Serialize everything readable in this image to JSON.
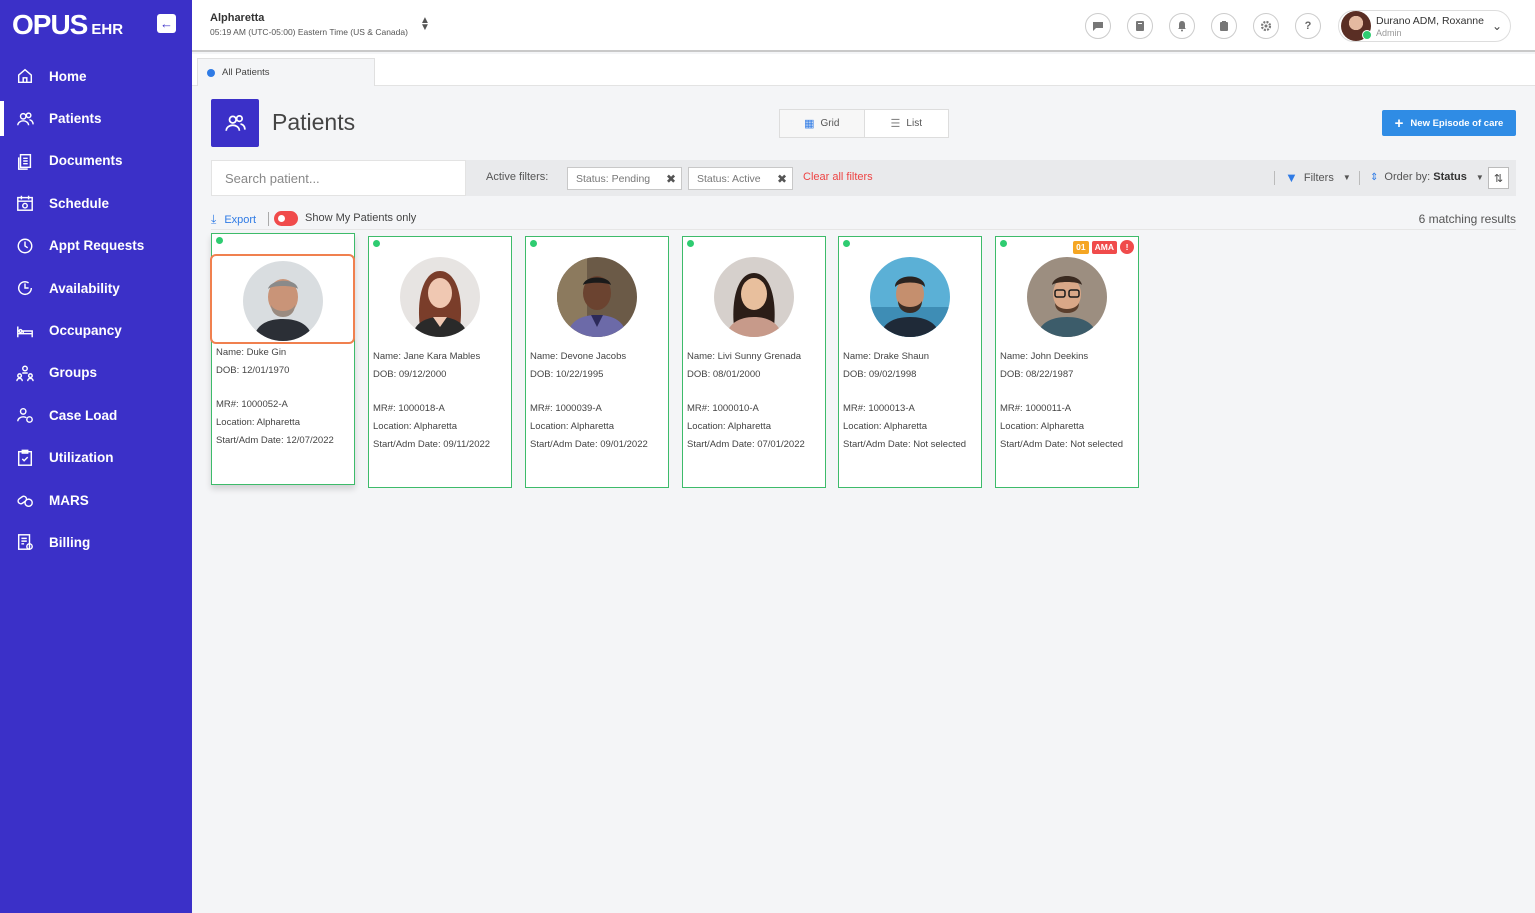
{
  "app": {
    "logo": "OPUS",
    "logo_sub": "EHR"
  },
  "sidebar": {
    "items": [
      {
        "label": "Home",
        "icon": "home-icon"
      },
      {
        "label": "Patients",
        "icon": "patients-icon",
        "active": true
      },
      {
        "label": "Documents",
        "icon": "documents-icon"
      },
      {
        "label": "Schedule",
        "icon": "schedule-icon"
      },
      {
        "label": "Appt Requests",
        "icon": "clock-icon"
      },
      {
        "label": "Availability",
        "icon": "availability-icon"
      },
      {
        "label": "Occupancy",
        "icon": "bed-icon"
      },
      {
        "label": "Groups",
        "icon": "groups-icon"
      },
      {
        "label": "Case Load",
        "icon": "case-load-icon"
      },
      {
        "label": "Utilization",
        "icon": "clipboard-icon"
      },
      {
        "label": "MARS",
        "icon": "pills-icon"
      },
      {
        "label": "Billing",
        "icon": "billing-icon"
      }
    ]
  },
  "topbar": {
    "location": "Alpharetta",
    "time": "05:19 AM (UTC-05:00) Eastern Time (US & Canada)",
    "user_name": "Durano ADM, Roxanne",
    "user_role": "Admin"
  },
  "tabs": [
    {
      "label": "All Patients"
    }
  ],
  "header": {
    "title": "Patients",
    "view_grid": "Grid",
    "view_list": "List",
    "new_button": "New Episode of care"
  },
  "filters": {
    "search_placeholder": "Search patient...",
    "active_label": "Active filters:",
    "chips": [
      "Status: Pending",
      "Status: Active"
    ],
    "clear_all": "Clear all filters",
    "filters_label": "Filters",
    "order_label": "Order by:",
    "order_value": "Status"
  },
  "toolbar": {
    "export": "Export",
    "show_mine": "Show My Patients only",
    "results": "6 matching results"
  },
  "patients": [
    {
      "name": "Name: Duke Gin",
      "dob": "DOB: 12/01/1970",
      "mr": "MR#: 1000052-A",
      "location": "Location: Alpharetta",
      "start": "Start/Adm Date: 12/07/2022"
    },
    {
      "name": "Name: Jane Kara Mables",
      "dob": "DOB: 09/12/2000",
      "mr": "MR#: 1000018-A",
      "location": "Location: Alpharetta",
      "start": "Start/Adm Date: 09/11/2022"
    },
    {
      "name": "Name: Devone Jacobs",
      "dob": "DOB: 10/22/1995",
      "mr": "MR#: 1000039-A",
      "location": "Location: Alpharetta",
      "start": "Start/Adm Date: 09/01/2022"
    },
    {
      "name": "Name: Livi Sunny Grenada",
      "dob": "DOB: 08/01/2000",
      "mr": "MR#: 1000010-A",
      "location": "Location: Alpharetta",
      "start": "Start/Adm Date: 07/01/2022"
    },
    {
      "name": "Name: Drake Shaun",
      "dob": "DOB: 09/02/1998",
      "mr": "MR#: 1000013-A",
      "location": "Location: Alpharetta",
      "start": "Start/Adm Date: Not selected"
    },
    {
      "name": "Name: John Deekins",
      "dob": "DOB: 08/22/1987",
      "mr": "MR#: 1000011-A",
      "location": "Location: Alpharetta",
      "start": "Start/Adm Date: Not selected",
      "badges": [
        "01",
        "AMA",
        "!"
      ]
    }
  ],
  "colors": {
    "sidebar": "#3b30c8",
    "accent": "#2f8ce5",
    "status_active": "#2ecc71",
    "card_border": "#3dbb6a",
    "danger": "#f04b4b"
  }
}
